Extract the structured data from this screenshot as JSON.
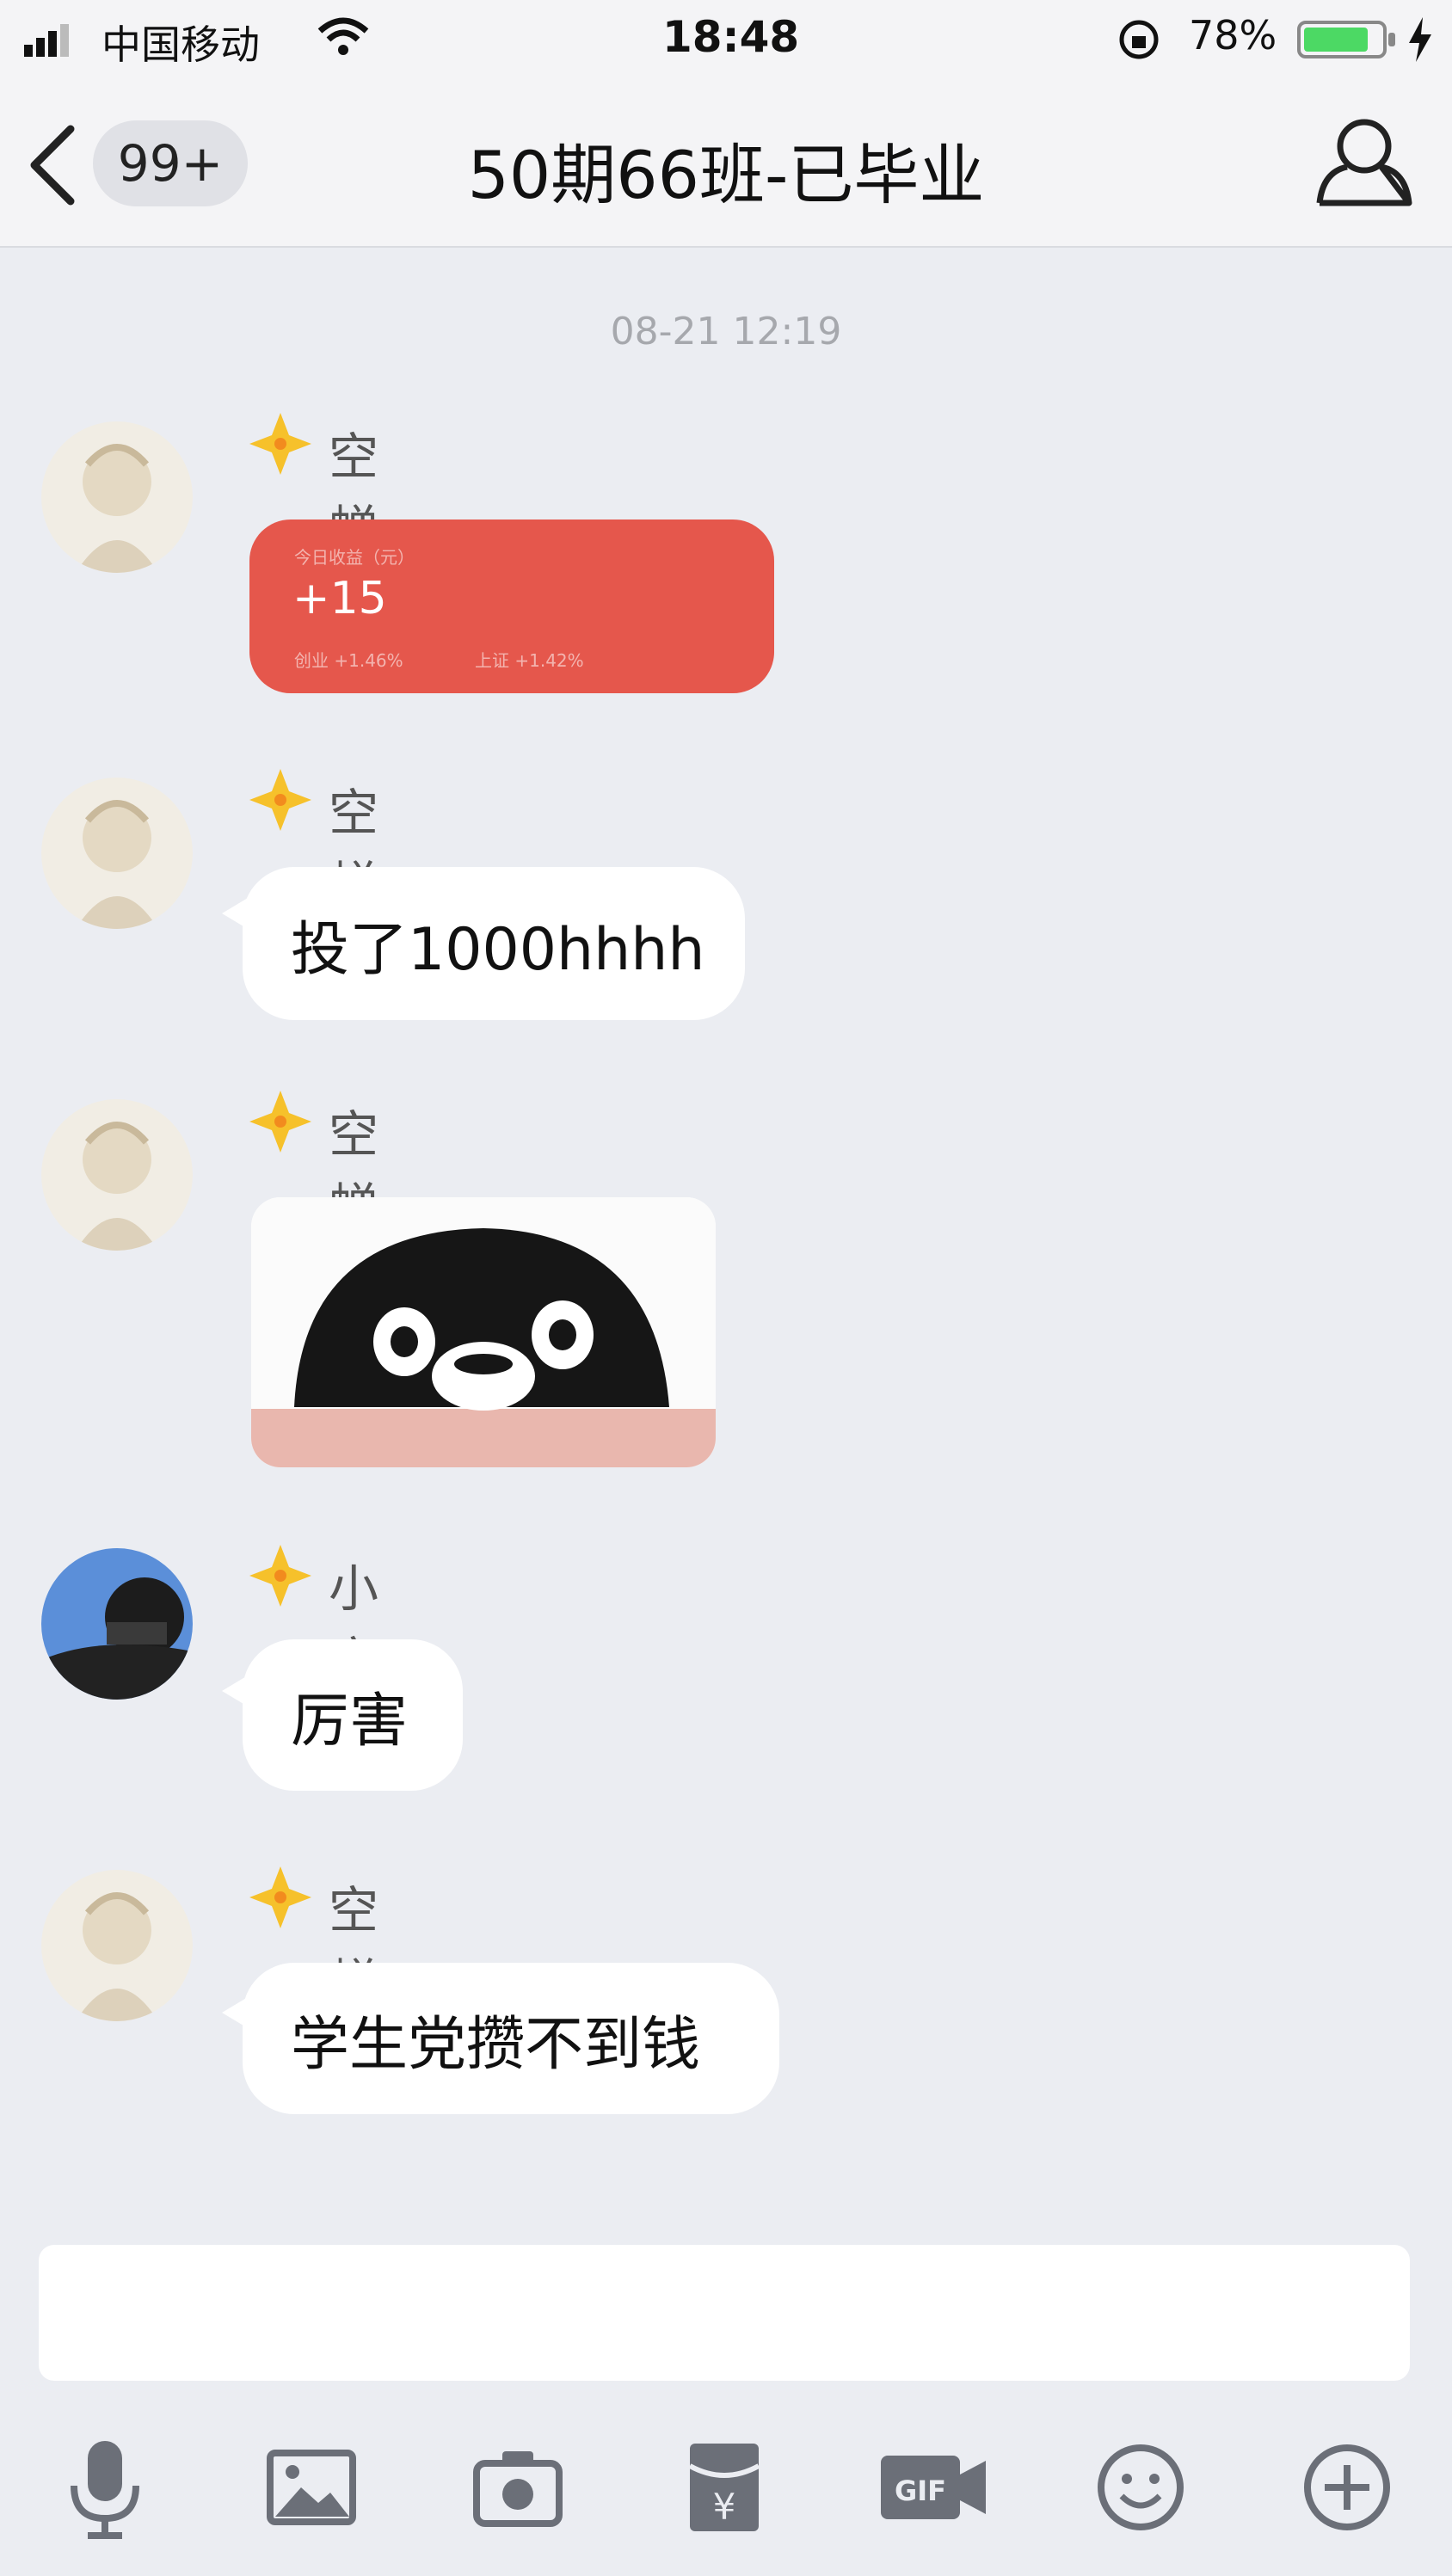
{
  "status_bar": {
    "carrier": "中国移动",
    "time": "18:48",
    "battery": "78%"
  },
  "nav": {
    "back_badge": "99+",
    "title": "50期66班-已毕业",
    "members_icon": "person-icon"
  },
  "chat": {
    "timestamp": "08-21 12:19",
    "messages": [
      {
        "sender": "空蝉",
        "type": "stock_card",
        "card": {
          "header": "今日收益（元）",
          "value": "+15",
          "footer_left": "创业  +1.46%",
          "footer_right": "上证  +1.42%"
        }
      },
      {
        "sender": "空蝉",
        "type": "text",
        "text": "投了1000hhhh"
      },
      {
        "sender": "空蝉",
        "type": "sticker",
        "sticker": "penguin-sticker"
      },
      {
        "sender": "小方",
        "type": "text",
        "text": "厉害"
      },
      {
        "sender": "空蝉",
        "type": "text",
        "text": "学生党攒不到钱"
      }
    ]
  },
  "input": {
    "value": "",
    "placeholder": ""
  },
  "toolbar": {
    "icons": [
      "microphone-icon",
      "image-icon",
      "camera-icon",
      "red-packet-icon",
      "gif-icon",
      "emoji-icon",
      "plus-icon"
    ]
  },
  "colors": {
    "background": "#ebedf2",
    "stock_card": "#e5574c",
    "bubble": "#ffffff",
    "badge_star": "#f6c12b"
  }
}
